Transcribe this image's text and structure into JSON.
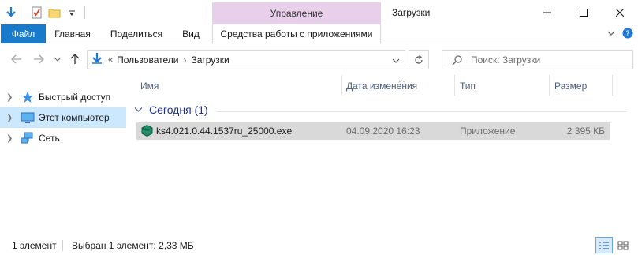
{
  "titlebar": {
    "context_group": "Управление",
    "window_title": "Загрузки"
  },
  "ribbon": {
    "tabs": [
      "Файл",
      "Главная",
      "Поделиться",
      "Вид",
      "Средства работы с приложениями"
    ]
  },
  "address": {
    "crumbs": [
      "Пользователи",
      "Загрузки"
    ],
    "search_placeholder": "Поиск: Загрузки"
  },
  "nav": {
    "items": [
      {
        "label": "Быстрый доступ",
        "icon": "star-icon"
      },
      {
        "label": "Этот компьютер",
        "icon": "computer-icon",
        "selected": true
      },
      {
        "label": "Сеть",
        "icon": "network-icon"
      }
    ]
  },
  "columns": [
    "Имя",
    "Дата изменения",
    "Тип",
    "Размер"
  ],
  "group": {
    "label": "Сегодня (1)"
  },
  "files": [
    {
      "name": "ks4.021.0.44.1537ru_25000.exe",
      "date": "04.09.2020 16:23",
      "type": "Приложение",
      "size": "2 395 КБ"
    }
  ],
  "status": {
    "count": "1 элемент",
    "selection": "Выбран 1 элемент: 2,33 МБ"
  },
  "colors": {
    "accent": "#1979ca",
    "context_tab": "#e8cfea",
    "selected": "#cce8ff",
    "header_text": "#4d6082",
    "group_text": "#1e3287"
  }
}
